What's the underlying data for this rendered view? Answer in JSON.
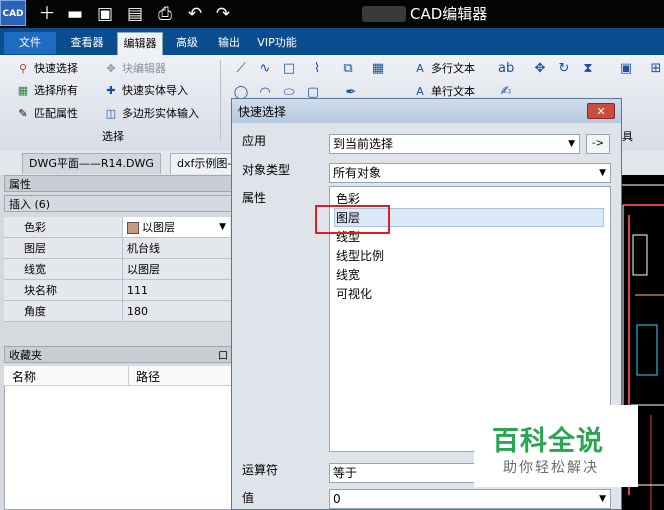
{
  "app": {
    "logo": "CAD",
    "title": "CAD编辑器"
  },
  "ribbon_tabs": [
    "文件",
    "查看器",
    "编辑器",
    "高级",
    "输出",
    "VIP功能"
  ],
  "ribbon": {
    "items": [
      "快速选择",
      "块编辑器",
      "选择所有",
      "快速实体导入",
      "匹配属性",
      "多边形实体输入"
    ],
    "group_label": "选择",
    "right_items": [
      "多行文本",
      "单行文本"
    ],
    "cut_label": "具"
  },
  "doc_tabs": [
    "DWG平面——R14.DWG",
    "dxf示例图-"
  ],
  "props_panel": {
    "title": "属性",
    "insert_label": "插入 (6)",
    "rows": [
      {
        "key": "色彩",
        "value": "以图层",
        "swatch": "#c89a7a"
      },
      {
        "key": "图层",
        "value": "机台线"
      },
      {
        "key": "线宽",
        "value": "以图层"
      },
      {
        "key": "块名称",
        "value": "111"
      },
      {
        "key": "角度",
        "value": "180"
      }
    ]
  },
  "favorites": {
    "title": "收藏夹",
    "pin": "口",
    "columns": [
      "名称",
      "路径"
    ]
  },
  "dialog": {
    "title": "快速选择",
    "close": "✕",
    "apply_label": "应用",
    "apply_value": "到当前选择",
    "pick_button": "->",
    "object_type_label": "对象类型",
    "object_type_value": "所有对象",
    "property_label": "属性",
    "properties": [
      "色彩",
      "图层",
      "线型",
      "线型比例",
      "线宽",
      "可视化"
    ],
    "selected_property": "图层",
    "operator_label": "运算符",
    "operator_value": "等于",
    "value_label": "值",
    "value_value": "0"
  },
  "watermark": {
    "main": "百科全说",
    "sub": "助你轻松解决"
  },
  "colors": {
    "accent": "#0a4d8f",
    "highlight": "#e02020",
    "watermark": "#2aa653"
  }
}
